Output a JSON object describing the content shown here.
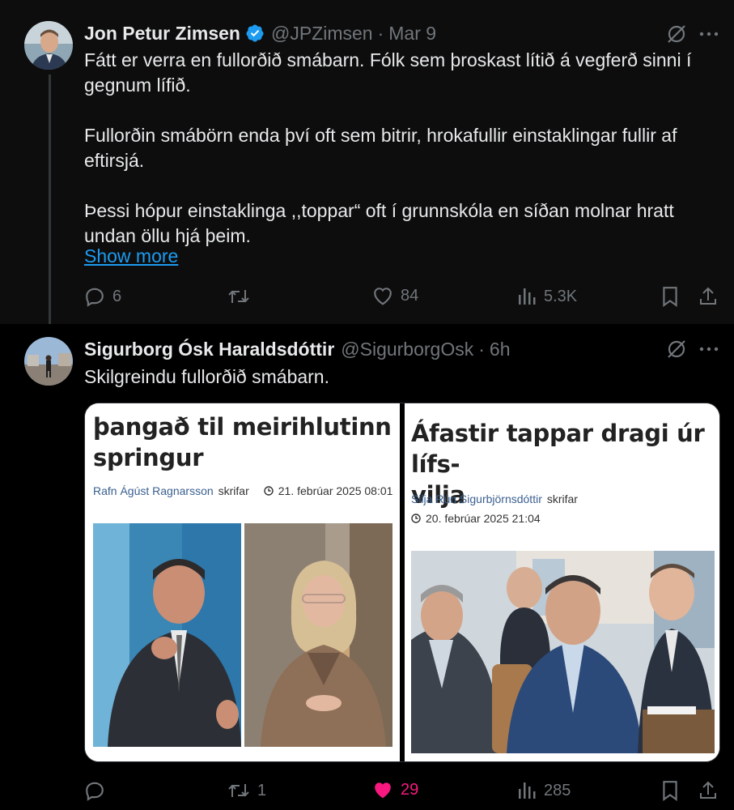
{
  "tweet1": {
    "author_name": "Jon Petur Zimsen",
    "handle": "@JPZimsen",
    "separator": "·",
    "timestamp": "Mar 9",
    "verified": true,
    "paragraphs": [
      "Fátt er verra en fullorðið smábarn. Fólk sem þroskast lítið á vegferð sinni í gegnum lífið.",
      "Fullorðin smábörn enda því oft sem bitrir, hrokafullir einstaklingar fullir af eftirsjá.",
      "Þessi hópur einstaklinga ,,toppar“ oft í grunnskóla en síðan molnar hratt undan öllu hjá þeim."
    ],
    "show_more": "Show more",
    "reply_count": "6",
    "retweet_count": "",
    "like_count": "84",
    "view_count": "5.3K"
  },
  "tweet2": {
    "author_name": "Sigurborg Ósk Haraldsdóttir",
    "handle": "@SigurborgOsk",
    "separator": "·",
    "timestamp": "6h",
    "text": "Skilgreindu fullorðið smábarn.",
    "reply_count": "",
    "retweet_count": "1",
    "like_count": "29",
    "view_count": "285",
    "liked": true
  },
  "article_left": {
    "headline_line1": "þangað til meirihlutinn",
    "headline_line2": "springur",
    "author": "Rafn Ágúst Ragnarsson",
    "author_suffix": "skrifar",
    "date": "21. febrúar 2025 08:01"
  },
  "article_right": {
    "headline_line1": "Áfastir tappar dragi úr lífs-",
    "headline_line2": "vilja",
    "author": "Silja Rún Sigurbjörnsdóttir",
    "author_suffix": "skrifar",
    "date": "20. febrúar 2025 21:04"
  },
  "icons": {
    "reply": "reply-icon",
    "retweet": "retweet-icon",
    "like": "heart-icon",
    "views": "views-icon",
    "bookmark": "bookmark-icon",
    "share": "share-icon",
    "grok": "grok-icon",
    "more": "more-icon"
  },
  "colors": {
    "link": "#1d9bf0",
    "like_active": "#f91880",
    "muted": "#71767b",
    "verified": "#1d9bf0"
  }
}
